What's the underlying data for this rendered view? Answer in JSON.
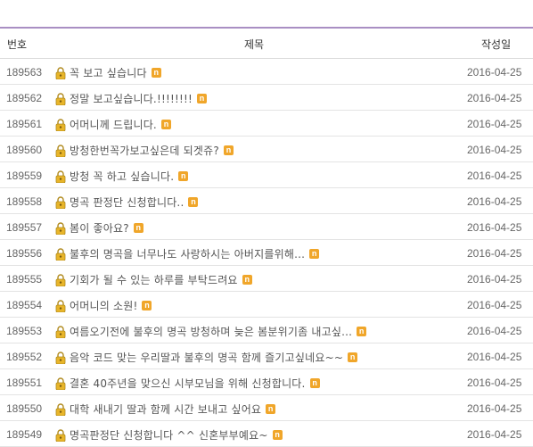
{
  "table": {
    "headers": {
      "number": "번호",
      "title": "제목",
      "date": "작성일"
    },
    "new_badge": "n",
    "rows": [
      {
        "number": "189563",
        "title": "꼭 보고 싶습니다",
        "date": "2016-04-25"
      },
      {
        "number": "189562",
        "title": "정말 보고싶습니다.!!!!!!!!",
        "date": "2016-04-25"
      },
      {
        "number": "189561",
        "title": "어머니께 드립니다.",
        "date": "2016-04-25"
      },
      {
        "number": "189560",
        "title": "방청한번꼭가보고싶은데 되겟쥬?",
        "date": "2016-04-25"
      },
      {
        "number": "189559",
        "title": "방청 꼭 하고 싶습니다.",
        "date": "2016-04-25"
      },
      {
        "number": "189558",
        "title": "명곡 판정단 신청합니다..",
        "date": "2016-04-25"
      },
      {
        "number": "189557",
        "title": "봄이 좋아요?",
        "date": "2016-04-25"
      },
      {
        "number": "189556",
        "title": "불후의 명곡을 너무나도 사랑하시는 아버지를위해...",
        "date": "2016-04-25"
      },
      {
        "number": "189555",
        "title": "기회가 될 수 있는 하루를 부탁드려요",
        "date": "2016-04-25"
      },
      {
        "number": "189554",
        "title": "어머니의 소원!",
        "date": "2016-04-25"
      },
      {
        "number": "189553",
        "title": "여름오기전에 불후의 명곡 방청하며 늦은 봄분위기좀 내고싶...",
        "date": "2016-04-25"
      },
      {
        "number": "189552",
        "title": "음악 코드 맞는 우리딸과 불후의 명곡 함께 즐기고싶네요~~",
        "date": "2016-04-25"
      },
      {
        "number": "189551",
        "title": "결혼 40주년을 맞으신 시부모님을 위해 신청합니다.",
        "date": "2016-04-25"
      },
      {
        "number": "189550",
        "title": "대학 새내기 딸과 함께 시간 보내고 싶어요",
        "date": "2016-04-25"
      },
      {
        "number": "189549",
        "title": "명곡판정단 신청합니다 ^^ 신혼부부예요~",
        "date": "2016-04-25"
      }
    ]
  }
}
